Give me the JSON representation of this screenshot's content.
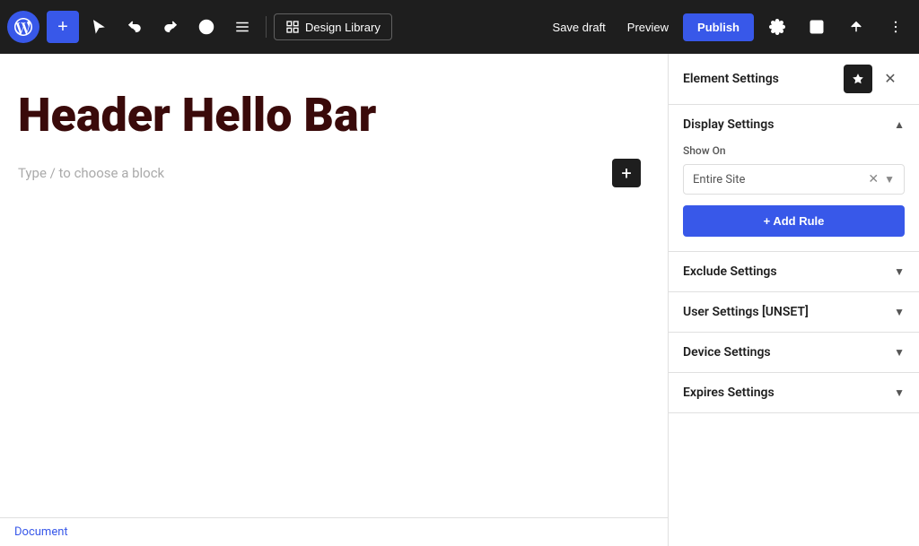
{
  "toolbar": {
    "add_label": "+",
    "design_library_label": "Design Library",
    "save_draft_label": "Save draft",
    "preview_label": "Preview",
    "publish_label": "Publish"
  },
  "canvas": {
    "title": "Header Hello Bar",
    "placeholder_text": "Type / to choose a block",
    "add_block_label": "+",
    "bottom_bar_label": "Document"
  },
  "right_panel": {
    "title": "Element Settings",
    "display_settings": {
      "section_label": "Display Settings",
      "show_on_label": "Show On",
      "show_on_value": "Entire Site",
      "add_rule_label": "+ Add Rule"
    },
    "exclude_settings": {
      "section_label": "Exclude Settings"
    },
    "user_settings": {
      "section_label": "User Settings [UNSET]"
    },
    "device_settings": {
      "section_label": "Device Settings"
    },
    "expires_settings": {
      "section_label": "Expires Settings"
    }
  },
  "colors": {
    "accent": "#3858e9",
    "title_color": "#3a0a0a",
    "dark_bg": "#1e1e1e"
  }
}
